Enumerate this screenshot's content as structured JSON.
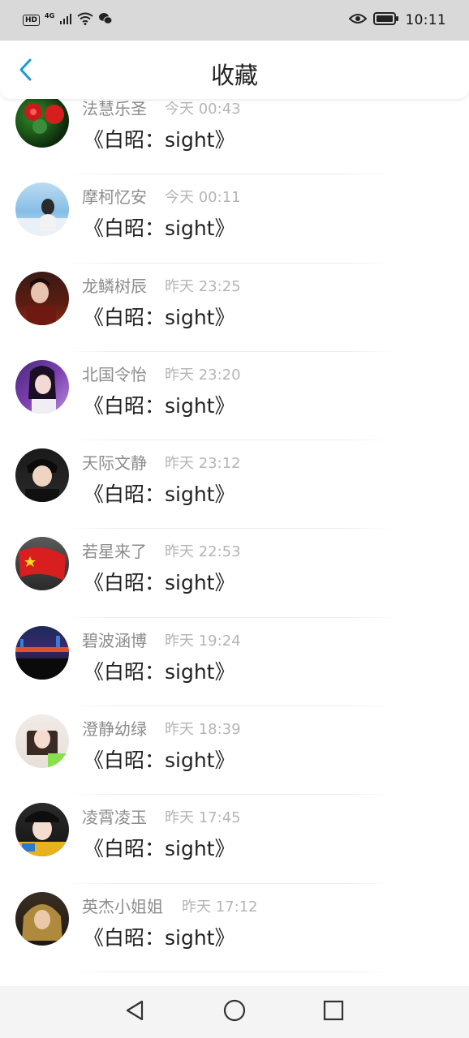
{
  "status_bar": {
    "hd": "HD",
    "network": "4G",
    "time": "10:11"
  },
  "header": {
    "title": "收藏"
  },
  "items": [
    {
      "user": "法慧乐圣",
      "time": "今天 00:43",
      "title": "《白昭：sight》"
    },
    {
      "user": "摩柯忆安",
      "time": "今天 00:11",
      "title": "《白昭：sight》"
    },
    {
      "user": "龙鳞树辰",
      "time": "昨天 23:25",
      "title": "《白昭：sight》"
    },
    {
      "user": "北国令怡",
      "time": "昨天 23:20",
      "title": "《白昭：sight》"
    },
    {
      "user": "天际文静",
      "time": "昨天 23:12",
      "title": "《白昭：sight》"
    },
    {
      "user": "若星来了",
      "time": "昨天 22:53",
      "title": "《白昭：sight》"
    },
    {
      "user": "碧波涵博",
      "time": "昨天 19:24",
      "title": "《白昭：sight》"
    },
    {
      "user": "澄静幼绿",
      "time": "昨天 18:39",
      "title": "《白昭：sight》"
    },
    {
      "user": "凌霄凌玉",
      "time": "昨天 17:45",
      "title": "《白昭：sight》"
    },
    {
      "user": "英杰小姐姐",
      "time": "昨天 17:12",
      "title": "《白昭：sight》"
    }
  ],
  "colors": {
    "accent": "#1a9bd7",
    "username": "#8c8c8c",
    "time": "#b5b5b5",
    "title": "#222222"
  },
  "icons": {
    "back": "chevron-left-icon",
    "nav_back": "triangle-back-icon",
    "nav_home": "circle-home-icon",
    "nav_recent": "square-recent-icon"
  }
}
